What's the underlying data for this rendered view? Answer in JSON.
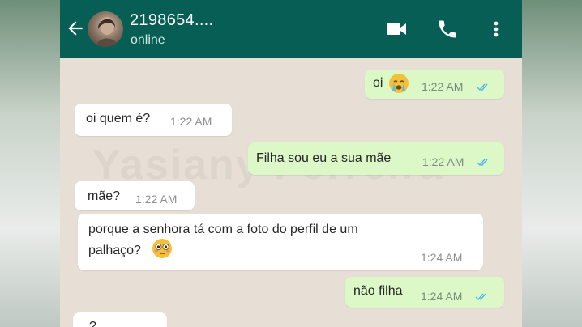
{
  "header": {
    "contact_name": "2198654....",
    "status": "online"
  },
  "icons": {
    "back": "arrow-left-icon",
    "video": "video-call-icon",
    "call": "phone-icon",
    "menu": "more-vertical-icon"
  },
  "colors": {
    "header_bg": "#075e54",
    "outgoing_bubble": "#dcf8c6",
    "incoming_bubble": "#ffffff",
    "chat_bg": "#e7dfd6",
    "read_ticks": "#4fb6ec"
  },
  "watermark": "Yasiany Ferreira",
  "messages": [
    {
      "direction": "out",
      "text": "oi",
      "emoji": "crying-face-emoji",
      "time": "1:22 AM",
      "read": true
    },
    {
      "direction": "in",
      "text": "oi quem é?",
      "time": "1:22 AM"
    },
    {
      "direction": "out",
      "text": "Filha sou eu a sua mãe",
      "time": "1:22 AM",
      "read": true
    },
    {
      "direction": "in",
      "text": "mãe?",
      "time": "1:22 AM"
    },
    {
      "direction": "in",
      "text_line1": "porque a senhora tá com a foto do perfil de um",
      "text_line2": "palhaço?",
      "emoji": "flushed-face-emoji",
      "time": "1:24 AM"
    },
    {
      "direction": "out",
      "text": "não filha",
      "time": "1:24 AM",
      "read": true
    },
    {
      "direction": "in",
      "text": "?"
    }
  ]
}
